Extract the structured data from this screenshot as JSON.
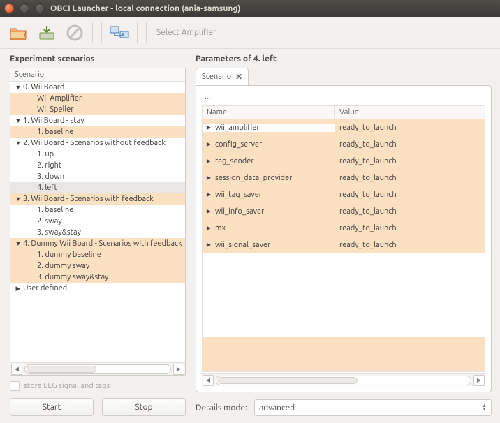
{
  "window": {
    "title": "OBCI Launcher - local connection (ania-samsung)"
  },
  "toolbar": {
    "select_amp": "Select Amplifier"
  },
  "left": {
    "title": "Experiment scenarios",
    "column": "Scenario",
    "store_label": "store EEG signal and tags",
    "start": "Start",
    "stop": "Stop",
    "tree": [
      {
        "kind": "group",
        "label": "0. Wii Board",
        "expanded": true
      },
      {
        "kind": "item",
        "label": "Wii Amplifier",
        "hi": true
      },
      {
        "kind": "item",
        "label": "Wii Speller",
        "hi": true
      },
      {
        "kind": "group",
        "label": "1. Wii Board - stay",
        "expanded": true
      },
      {
        "kind": "item",
        "label": "1. baseline",
        "hi": true
      },
      {
        "kind": "group",
        "label": "2. Wii Board - Scenarios without feedback",
        "expanded": true
      },
      {
        "kind": "item",
        "label": "1. up"
      },
      {
        "kind": "item",
        "label": "2. right"
      },
      {
        "kind": "item",
        "label": "3. down"
      },
      {
        "kind": "item",
        "label": "4. left",
        "sel": true
      },
      {
        "kind": "group",
        "label": "3. Wii Board - Scenarios with feedback",
        "expanded": true,
        "hi": true
      },
      {
        "kind": "item",
        "label": "1. baseline"
      },
      {
        "kind": "item",
        "label": "2. sway"
      },
      {
        "kind": "item",
        "label": "3. sway&stay"
      },
      {
        "kind": "group",
        "label": "4. Dummy Wii Board - Scenarios with feedback",
        "expanded": true,
        "hi": true
      },
      {
        "kind": "item",
        "label": "1. dummy baseline",
        "hi": true
      },
      {
        "kind": "item",
        "label": "2. dummy sway",
        "hi": true
      },
      {
        "kind": "item",
        "label": "3. dummy sway&stay",
        "hi": true
      },
      {
        "kind": "group",
        "label": "User defined",
        "expanded": false
      }
    ]
  },
  "right": {
    "title": "Parameters of 4. left",
    "tab": "Scenario",
    "crumb": "...",
    "columns": {
      "name": "Name",
      "value": "Value"
    },
    "rows": [
      {
        "name": "wii_amplifier",
        "value": "ready_to_launch"
      },
      {
        "name": "config_server",
        "value": "ready_to_launch"
      },
      {
        "name": "tag_sender",
        "value": "ready_to_launch"
      },
      {
        "name": "session_data_provider",
        "value": "ready_to_launch"
      },
      {
        "name": "wii_tag_saver",
        "value": "ready_to_launch"
      },
      {
        "name": "wii_info_saver",
        "value": "ready_to_launch"
      },
      {
        "name": "mx",
        "value": "ready_to_launch"
      },
      {
        "name": "wii_signal_saver",
        "value": "ready_to_launch"
      }
    ],
    "details_label": "Details mode:",
    "details_value": "advanced"
  }
}
